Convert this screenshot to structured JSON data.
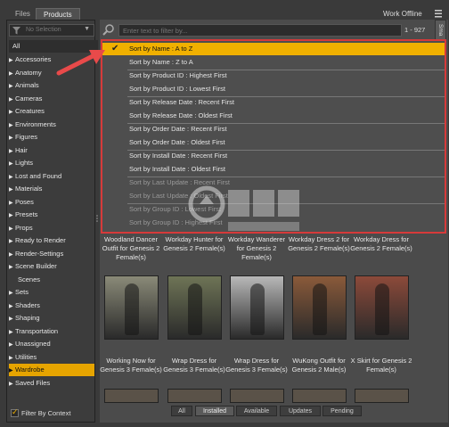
{
  "tabs": [
    "Files",
    "Products"
  ],
  "work_offline": "Work Offline",
  "dropdown_icon": "chevron-down-icon",
  "no_selection": "No Selection",
  "search_placeholder": "Enter text to filter by...",
  "range": "1 - 927",
  "side_tab_label": "Sma",
  "sidebar": {
    "all": "All",
    "items": [
      "Accessories",
      "Anatomy",
      "Animals",
      "Cameras",
      "Creatures",
      "Environments",
      "Figures",
      "Hair",
      "Lights",
      "Lost and Found",
      "Materials",
      "Poses",
      "Presets",
      "Props",
      "Ready to Render",
      "Render-Settings",
      "Scene Builder",
      "Scenes",
      "Sets",
      "Shaders",
      "Shaping",
      "Transportation",
      "Unassigned",
      "Utilities",
      "Wardrobe",
      "Saved Files"
    ],
    "selected": "Wardrobe",
    "filter_by_context": "Filter By Context"
  },
  "sort_menu": {
    "items": [
      "Sort by Name : A to Z",
      "Sort by Name : Z to A",
      "Sort by Product ID : Highest First",
      "Sort by Product ID : Lowest First",
      "Sort by Release Date : Recent First",
      "Sort by Release Date : Oldest First",
      "Sort by Order Date : Recent First",
      "Sort by Order Date : Oldest First",
      "Sort by Install Date : Recent First",
      "Sort by Install Date : Oldest First",
      "Sort by Last Update : Recent First",
      "Sort by Last Update : Oldest First",
      "Sort by Group ID : Lowest First",
      "Sort by Group ID : Highest First"
    ],
    "checked": "Sort by Name : A to Z"
  },
  "products_row1": [
    {
      "name": "Woodland Dancer Outfit for Genesis 2 Female(s)",
      "color": "#7a6a4a"
    },
    {
      "name": "Workday Hunter for Genesis 2 Female(s)",
      "color": "#6a5a48"
    },
    {
      "name": "Workday Wanderer for Genesis 2 Female(s)",
      "color": "#6a6050"
    },
    {
      "name": "Workday Dress 2 for Genesis 2 Female(s)",
      "color": "#5c5048"
    },
    {
      "name": "Workday Dress for Genesis 2 Female(s)",
      "color": "#5a4a44"
    }
  ],
  "products_row2": [
    {
      "name": "Working Now for Genesis 3 Female(s)",
      "color": "#8a8a78"
    },
    {
      "name": "Wrap Dress for Genesis 3 Female(s)",
      "color": "#6e7456"
    },
    {
      "name": "Wrap Dress for Genesis 3 Female(s)",
      "color": "#b8b8b8"
    },
    {
      "name": "WuKong Outfit for Genesis 2 Male(s)",
      "color": "#8a5a3a"
    },
    {
      "name": "X Skirt for Genesis 2 Female(s)",
      "color": "#8c4a3a"
    }
  ],
  "footer_tabs": [
    "All",
    "Installed",
    "Available",
    "Updates",
    "Pending"
  ],
  "footer_active": "Installed",
  "colors": {
    "accent": "#f0b000",
    "highlight_border": "#d63a3a",
    "arrow": "#e84a4a"
  }
}
